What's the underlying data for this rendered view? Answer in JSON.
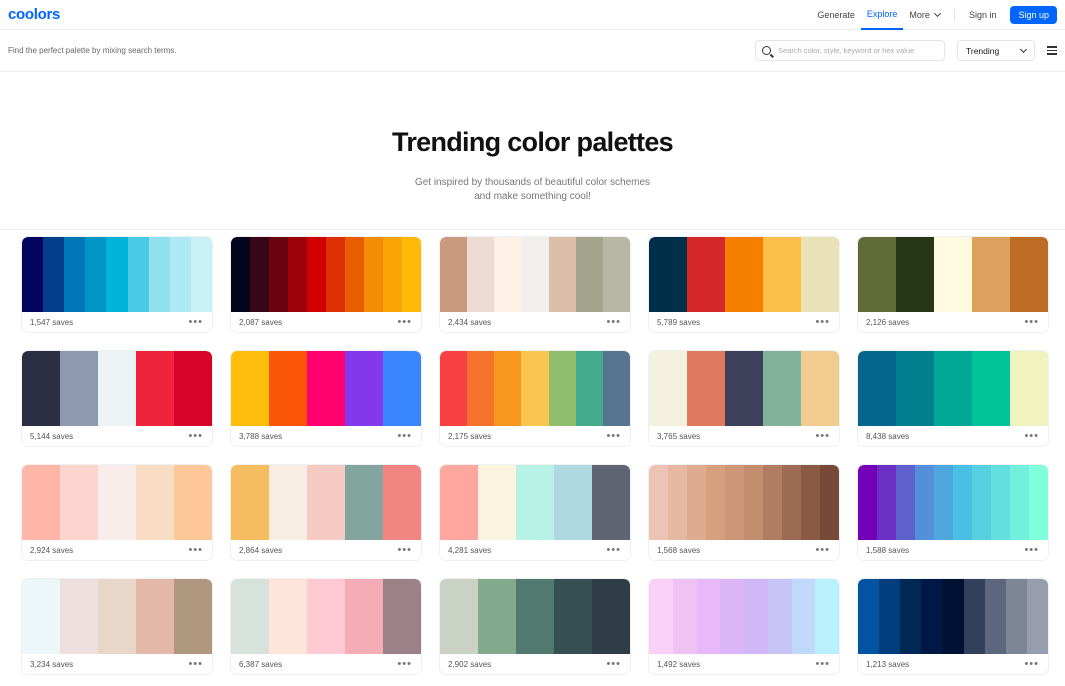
{
  "brand": {
    "logo": "coolors"
  },
  "nav": {
    "generate": "Generate",
    "explore": "Explore",
    "more": "More",
    "sign_in": "Sign in",
    "sign_up": "Sign up"
  },
  "toolbar": {
    "hint": "Find the perfect palette by mixing search terms.",
    "search_placeholder": "Search color, style, keyword or hex value",
    "sort_selected": "Trending"
  },
  "hero": {
    "title": "Trending color palettes",
    "subtitle": "Get inspired by thousands of beautiful color schemes and make something cool!"
  },
  "palettes": [
    {
      "saves": "1,547 saves",
      "colors": [
        "#03045e",
        "#023e8a",
        "#0077b6",
        "#0096c7",
        "#00b4d8",
        "#48cae4",
        "#90e0ef",
        "#ade8f4",
        "#caf0f8"
      ]
    },
    {
      "saves": "2,087 saves",
      "colors": [
        "#03071e",
        "#370617",
        "#6a040f",
        "#9d0208",
        "#d00000",
        "#dc2f02",
        "#e85d04",
        "#f48c06",
        "#faa307",
        "#ffba08"
      ]
    },
    {
      "saves": "2,434 saves",
      "colors": [
        "#cb997e",
        "#eddcd2",
        "#fff1e6",
        "#f0efeb",
        "#ddbea9",
        "#a5a58d",
        "#b7b7a4"
      ]
    },
    {
      "saves": "5,789 saves",
      "colors": [
        "#003049",
        "#d62828",
        "#f77f00",
        "#fcbf49",
        "#eae2b7"
      ]
    },
    {
      "saves": "2,126 saves",
      "colors": [
        "#606c38",
        "#283618",
        "#fefae0",
        "#dda15e",
        "#bc6c25"
      ]
    },
    {
      "saves": "5,144 saves",
      "colors": [
        "#2b2d42",
        "#8d99ae",
        "#edf2f4",
        "#ef233c",
        "#d90429"
      ]
    },
    {
      "saves": "3,788 saves",
      "colors": [
        "#ffbe0b",
        "#fb5607",
        "#ff006e",
        "#8338ec",
        "#3a86ff"
      ]
    },
    {
      "saves": "2,175 saves",
      "colors": [
        "#f94144",
        "#f3722c",
        "#f8961e",
        "#f9c74f",
        "#90be6d",
        "#43aa8b",
        "#577590"
      ]
    },
    {
      "saves": "3,765 saves",
      "colors": [
        "#f4f1de",
        "#e07a5f",
        "#3d405b",
        "#81b29a",
        "#f2cc8f"
      ]
    },
    {
      "saves": "8,438 saves",
      "colors": [
        "#05668d",
        "#028090",
        "#00a896",
        "#02c39a",
        "#f0f3bd"
      ]
    },
    {
      "saves": "2,924 saves",
      "colors": [
        "#ffb5a7",
        "#fcd5ce",
        "#f8edeb",
        "#f9dcc4",
        "#fec89a"
      ]
    },
    {
      "saves": "2,864 saves",
      "colors": [
        "#f6bd60",
        "#f7ede2",
        "#f5cac3",
        "#84a59d",
        "#f28482"
      ]
    },
    {
      "saves": "4,281 saves",
      "colors": [
        "#ffa69e",
        "#faf3dd",
        "#b8f2e6",
        "#aed9e0",
        "#5e6472"
      ]
    },
    {
      "saves": "1,568 saves",
      "colors": [
        "#edc4b3",
        "#e6b8a2",
        "#deab90",
        "#d69f7e",
        "#cd9777",
        "#c38e70",
        "#b07d62",
        "#9d6b53",
        "#8a5a44",
        "#774936"
      ]
    },
    {
      "saves": "1,588 saves",
      "colors": [
        "#7400b8",
        "#6930c3",
        "#5e60ce",
        "#5390d9",
        "#4ea8de",
        "#48bfe3",
        "#56cfe1",
        "#64dfdf",
        "#72efdd",
        "#80ffdb"
      ]
    },
    {
      "saves": "3,234 saves",
      "colors": [
        "#edf6f9",
        "#ede0dc",
        "#e8d6c8",
        "#e4b8a8",
        "#b09880"
      ]
    },
    {
      "saves": "6,387 saves",
      "colors": [
        "#d8e2dc",
        "#ffe5d9",
        "#ffcad4",
        "#f4acb7",
        "#9d8189"
      ]
    },
    {
      "saves": "2,902 saves",
      "colors": [
        "#cad2c5",
        "#84a98c",
        "#52796f",
        "#354f52",
        "#2f3e46"
      ]
    },
    {
      "saves": "1,492 saves",
      "colors": [
        "#f8d0f8",
        "#f0c2f4",
        "#e8b8f8",
        "#dcb4f8",
        "#d0b8f8",
        "#c8c4f8",
        "#c0d8fa",
        "#b8f0fc"
      ]
    },
    {
      "saves": "1,213 saves",
      "colors": [
        "#0353a4",
        "#023e7d",
        "#002855",
        "#001845",
        "#001233",
        "#33415c",
        "#5c677d",
        "#7d8597",
        "#979dac"
      ]
    }
  ]
}
